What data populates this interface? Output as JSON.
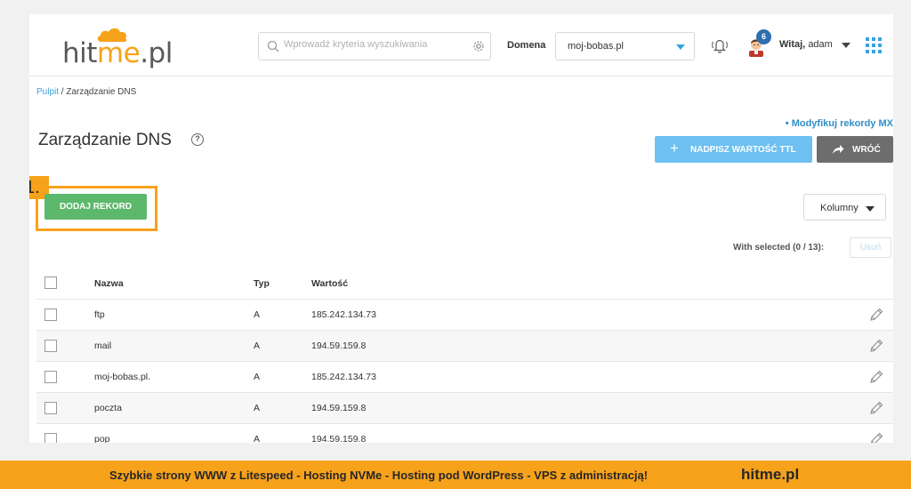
{
  "header": {
    "logo": {
      "part1": "hit",
      "part2": "me",
      "part3": ".pl"
    },
    "search": {
      "placeholder": "Wprowadź kryteria wyszukiwania",
      "value": ""
    },
    "domain_label": "Domena",
    "domain_value": "moj-bobas.pl",
    "notifications_count": "6",
    "greeting_prefix": "Witaj,",
    "greeting_user": "adam"
  },
  "breadcrumb": {
    "root": "Pulpit",
    "separator": " / ",
    "current": "Zarządzanie DNS"
  },
  "page": {
    "title": "Zarządzanie DNS",
    "help": "?",
    "mx_link": "• Modyfikuj rekordy MX",
    "ttl_button": "NADPISZ WARTOŚĆ TTL",
    "ttl_plus": "+",
    "back_button": "WRÓĆ",
    "step_number": "1.",
    "add_button": "DODAJ REKORD",
    "columns_button": "Kolumny",
    "with_selected": "With selected (0 / 13):",
    "remove_button": "Usuń"
  },
  "table": {
    "headers": {
      "name": "Nazwa",
      "type": "Typ",
      "value": "Wartość"
    },
    "rows": [
      {
        "name": "ftp",
        "type": "A",
        "value": "185.242.134.73"
      },
      {
        "name": "mail",
        "type": "A",
        "value": "194.59.159.8"
      },
      {
        "name": "moj-bobas.pl.",
        "type": "A",
        "value": "185.242.134.73"
      },
      {
        "name": "poczta",
        "type": "A",
        "value": "194.59.159.8"
      },
      {
        "name": "pop",
        "type": "A",
        "value": "194.59.159.8"
      }
    ]
  },
  "banner": {
    "text": "Szybkie strony WWW z Litespeed - Hosting  NVMe - Hosting pod WordPress - VPS z administracją!",
    "brand": "hitme.pl"
  },
  "colors": {
    "accent": "#39a3dc",
    "brand_orange": "#f7a21b",
    "add_green": "#5cb86b",
    "ttl_blue": "#6ec0f0",
    "back_gray": "#6d6d6d"
  },
  "icons": [
    "cloud-icon",
    "search-icon",
    "gear-icon",
    "bell-icon",
    "avatar-icon",
    "apps-grid-icon",
    "help-icon",
    "plus-icon",
    "share-arrow-icon",
    "pencil-icon"
  ]
}
